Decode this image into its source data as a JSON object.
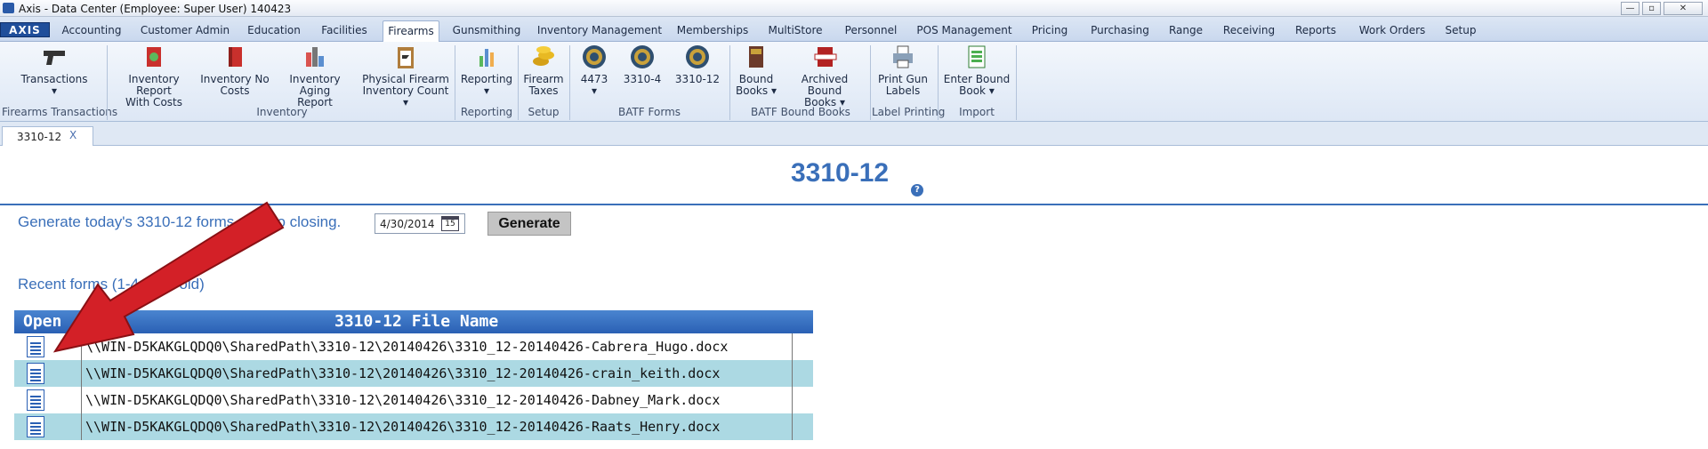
{
  "window": {
    "title": "Axis - Data Center  (Employee: Super User) 140423",
    "controls": [
      "—",
      "▫",
      "✕"
    ]
  },
  "menubar": {
    "logo": "AXIS",
    "tabs": [
      "Accounting",
      "Customer Admin",
      "Education",
      "Facilities",
      "Firearms",
      "Gunsmithing",
      "Inventory Management",
      "Memberships",
      "MultiStore",
      "Personnel",
      "POS Management",
      "Pricing",
      "Purchasing",
      "Range",
      "Receiving",
      "Reports",
      "Work Orders",
      "Setup"
    ],
    "active_tab": "Firearms"
  },
  "ribbon": {
    "buttons": [
      {
        "label": "Transactions\n▾",
        "icon": "pistol-icon"
      },
      {
        "label": "Inventory Report\nWith Costs",
        "icon": "inventory-costs-icon"
      },
      {
        "label": "Inventory No\nCosts",
        "icon": "inventory-no-costs-icon"
      },
      {
        "label": "Inventory Aging\nReport",
        "icon": "aging-report-icon"
      },
      {
        "label": "Physical Firearm\nInventory Count ▾",
        "icon": "clipboard-icon"
      },
      {
        "label": "Reporting\n▾",
        "icon": "reporting-chart-icon"
      },
      {
        "label": "Firearm\nTaxes",
        "icon": "coins-icon"
      },
      {
        "label": "4473\n▾",
        "icon": "atf-seal-icon"
      },
      {
        "label": "3310-4",
        "icon": "atf-seal-icon"
      },
      {
        "label": "3310-12",
        "icon": "atf-seal-icon"
      },
      {
        "label": "Bound\nBooks ▾",
        "icon": "bound-book-icon"
      },
      {
        "label": "Archived Bound\nBooks ▾",
        "icon": "archived-book-icon"
      },
      {
        "label": "Print Gun\nLabels",
        "icon": "printer-icon"
      },
      {
        "label": "Enter Bound\nBook ▾",
        "icon": "import-sheet-icon"
      }
    ],
    "groups": [
      "Firearms Transactions",
      "Inventory",
      "Reporting",
      "Setup",
      "BATF Forms",
      "BATF Bound Books",
      "Label Printing",
      "Import"
    ]
  },
  "doc_tab": {
    "label": "3310-12",
    "close": "X"
  },
  "page": {
    "title": "3310-12",
    "help": "?",
    "generate_text": "Generate today's 3310-12 forms prior to closing.",
    "date_value": "4/30/2014",
    "calendar_day": "15",
    "generate_button": "Generate",
    "recent_text": "Recent forms (1-4 days old)"
  },
  "table": {
    "headers": {
      "open": "Open",
      "name": "3310-12 File Name"
    },
    "rows": [
      "\\\\WIN-D5KAKGLQDQ0\\SharedPath\\3310-12\\20140426\\3310_12-20140426-Cabrera_Hugo.docx",
      "\\\\WIN-D5KAKGLQDQ0\\SharedPath\\3310-12\\20140426\\3310_12-20140426-crain_keith.docx",
      "\\\\WIN-D5KAKGLQDQ0\\SharedPath\\3310-12\\20140426\\3310_12-20140426-Dabney_Mark.docx",
      "\\\\WIN-D5KAKGLQDQ0\\SharedPath\\3310-12\\20140426\\3310_12-20140426-Raats_Henry.docx"
    ]
  },
  "colors": {
    "accent": "#3a6fb9",
    "row_alt": "#acd9e3",
    "arrow": "#d32027"
  }
}
